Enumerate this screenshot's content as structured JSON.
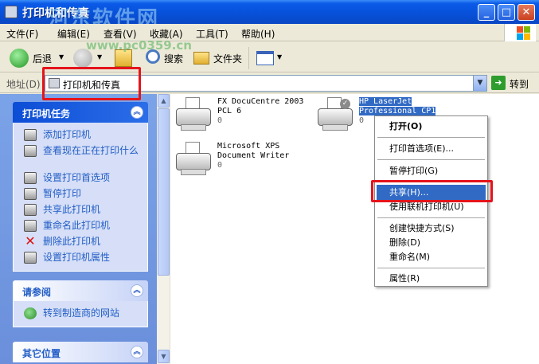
{
  "window": {
    "title": "打印机和传真"
  },
  "watermark": {
    "main": "河东软件网",
    "url": "www.pc0359.cn"
  },
  "menubar": {
    "items": [
      "文件(F)",
      "编辑(E)",
      "查看(V)",
      "收藏(A)",
      "工具(T)",
      "帮助(H)"
    ]
  },
  "toolbar": {
    "back_label": "后退",
    "search_label": "搜索",
    "folders_label": "文件夹"
  },
  "address": {
    "label": "地址(D)",
    "value": "打印机和传真",
    "go_label": "转到"
  },
  "sidebar": {
    "printer_tasks": {
      "title": "打印机任务",
      "items": [
        {
          "label": "添加打印机",
          "icon": "add-printer-icon"
        },
        {
          "label": "查看现在正在打印什么",
          "icon": "print-queue-icon"
        },
        {
          "label": "设置打印首选项",
          "icon": "preferences-icon"
        },
        {
          "label": "暂停打印",
          "icon": "pause-printer-icon"
        },
        {
          "label": "共享此打印机",
          "icon": "share-printer-icon"
        },
        {
          "label": "重命名此打印机",
          "icon": "rename-printer-icon"
        },
        {
          "label": "删除此打印机",
          "icon": "delete-icon"
        },
        {
          "label": "设置打印机属性",
          "icon": "properties-icon"
        }
      ]
    },
    "see_also": {
      "title": "请参阅",
      "items": [
        {
          "label": "转到制造商的网站",
          "icon": "globe-icon"
        }
      ]
    },
    "other_places": {
      "title": "其它位置"
    }
  },
  "printers": [
    {
      "name_line1": "FX DocuCentre 2003",
      "name_line2": "PCL 6",
      "count": "0"
    },
    {
      "name_line1": "HP LaserJet",
      "name_line2": "Professional CP1",
      "count": "0",
      "selected": true,
      "default": true
    },
    {
      "name_line1": "Microsoft XPS",
      "name_line2": "Document Writer",
      "count": "0"
    }
  ],
  "context_menu": {
    "items": [
      {
        "label": "打开(O)",
        "bold": true
      },
      {
        "label": "打印首选项(E)..."
      },
      {
        "label": "暂停打印(G)"
      },
      {
        "label": "共享(H)...",
        "highlighted": true
      },
      {
        "label": "使用联机打印机(U)"
      },
      {
        "label": "创建快捷方式(S)"
      },
      {
        "label": "删除(D)"
      },
      {
        "label": "重命名(M)"
      },
      {
        "label": "属性(R)"
      }
    ]
  },
  "colors": {
    "titlebar": "#0750d8",
    "selection": "#316ac5",
    "highlight_box": "#e5141c",
    "sidebar_link": "#215dc6"
  }
}
